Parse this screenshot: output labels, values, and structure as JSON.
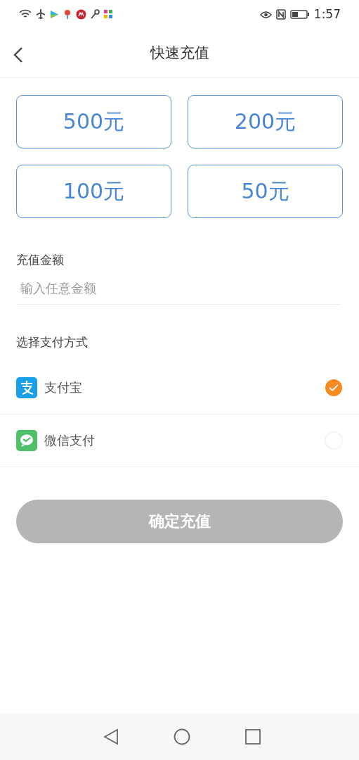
{
  "status_bar": {
    "time": "1:57"
  },
  "header": {
    "title": "快速充值"
  },
  "amount_options": [
    {
      "label": "500元",
      "selected": false
    },
    {
      "label": "200元",
      "selected": false
    },
    {
      "label": "100元",
      "selected": false
    },
    {
      "label": "50元",
      "selected": false
    }
  ],
  "custom_amount": {
    "label": "充值金额",
    "placeholder": "输入任意金额"
  },
  "payment": {
    "heading": "选择支付方式",
    "methods": [
      {
        "kind": "alipay",
        "label": "支付宝",
        "selected": true
      },
      {
        "kind": "wechat",
        "label": "微信支付",
        "selected": false
      }
    ]
  },
  "confirm_button": {
    "label": "确定充值",
    "disabled": true
  }
}
